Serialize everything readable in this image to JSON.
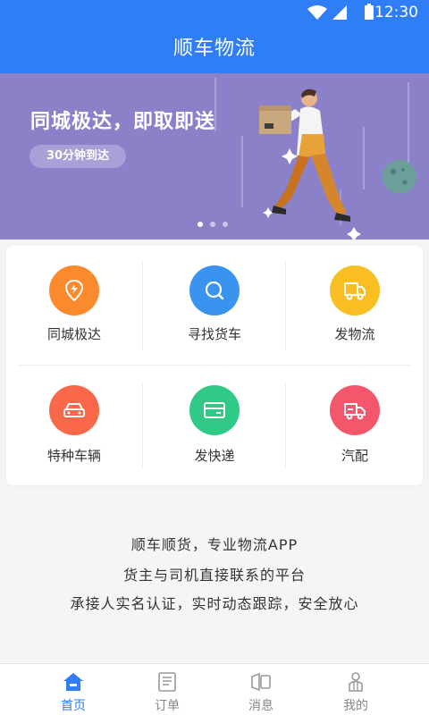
{
  "status": {
    "time": "12:30"
  },
  "header": {
    "title": "顺车物流"
  },
  "banner": {
    "title": "同城极达，即取即送",
    "badge": "30分钟到达"
  },
  "services": [
    {
      "label": "同城极达",
      "icon": "lightning-pin-icon",
      "color": "#fb8a2c"
    },
    {
      "label": "寻找货车",
      "icon": "search-icon",
      "color": "#3a93ee"
    },
    {
      "label": "发物流",
      "icon": "truck-icon",
      "color": "#f9bf22"
    },
    {
      "label": "特种车辆",
      "icon": "car-icon",
      "color": "#f86849"
    },
    {
      "label": "发快递",
      "icon": "package-icon",
      "color": "#2fca86"
    },
    {
      "label": "汽配",
      "icon": "delivery-truck-icon",
      "color": "#f4566c"
    }
  ],
  "slogans": [
    "顺车顺货，专业物流APP",
    "货主与司机直接联系的平台",
    "承接人实名认证，实时动态跟踪，安全放心"
  ],
  "tabs": [
    {
      "label": "首页",
      "icon": "home-icon",
      "active": true
    },
    {
      "label": "订单",
      "icon": "order-icon",
      "active": false
    },
    {
      "label": "消息",
      "icon": "message-icon",
      "active": false
    },
    {
      "label": "我的",
      "icon": "profile-icon",
      "active": false
    }
  ],
  "colors": {
    "primary": "#2f7ef6",
    "banner_bg": "#8b81c9"
  }
}
